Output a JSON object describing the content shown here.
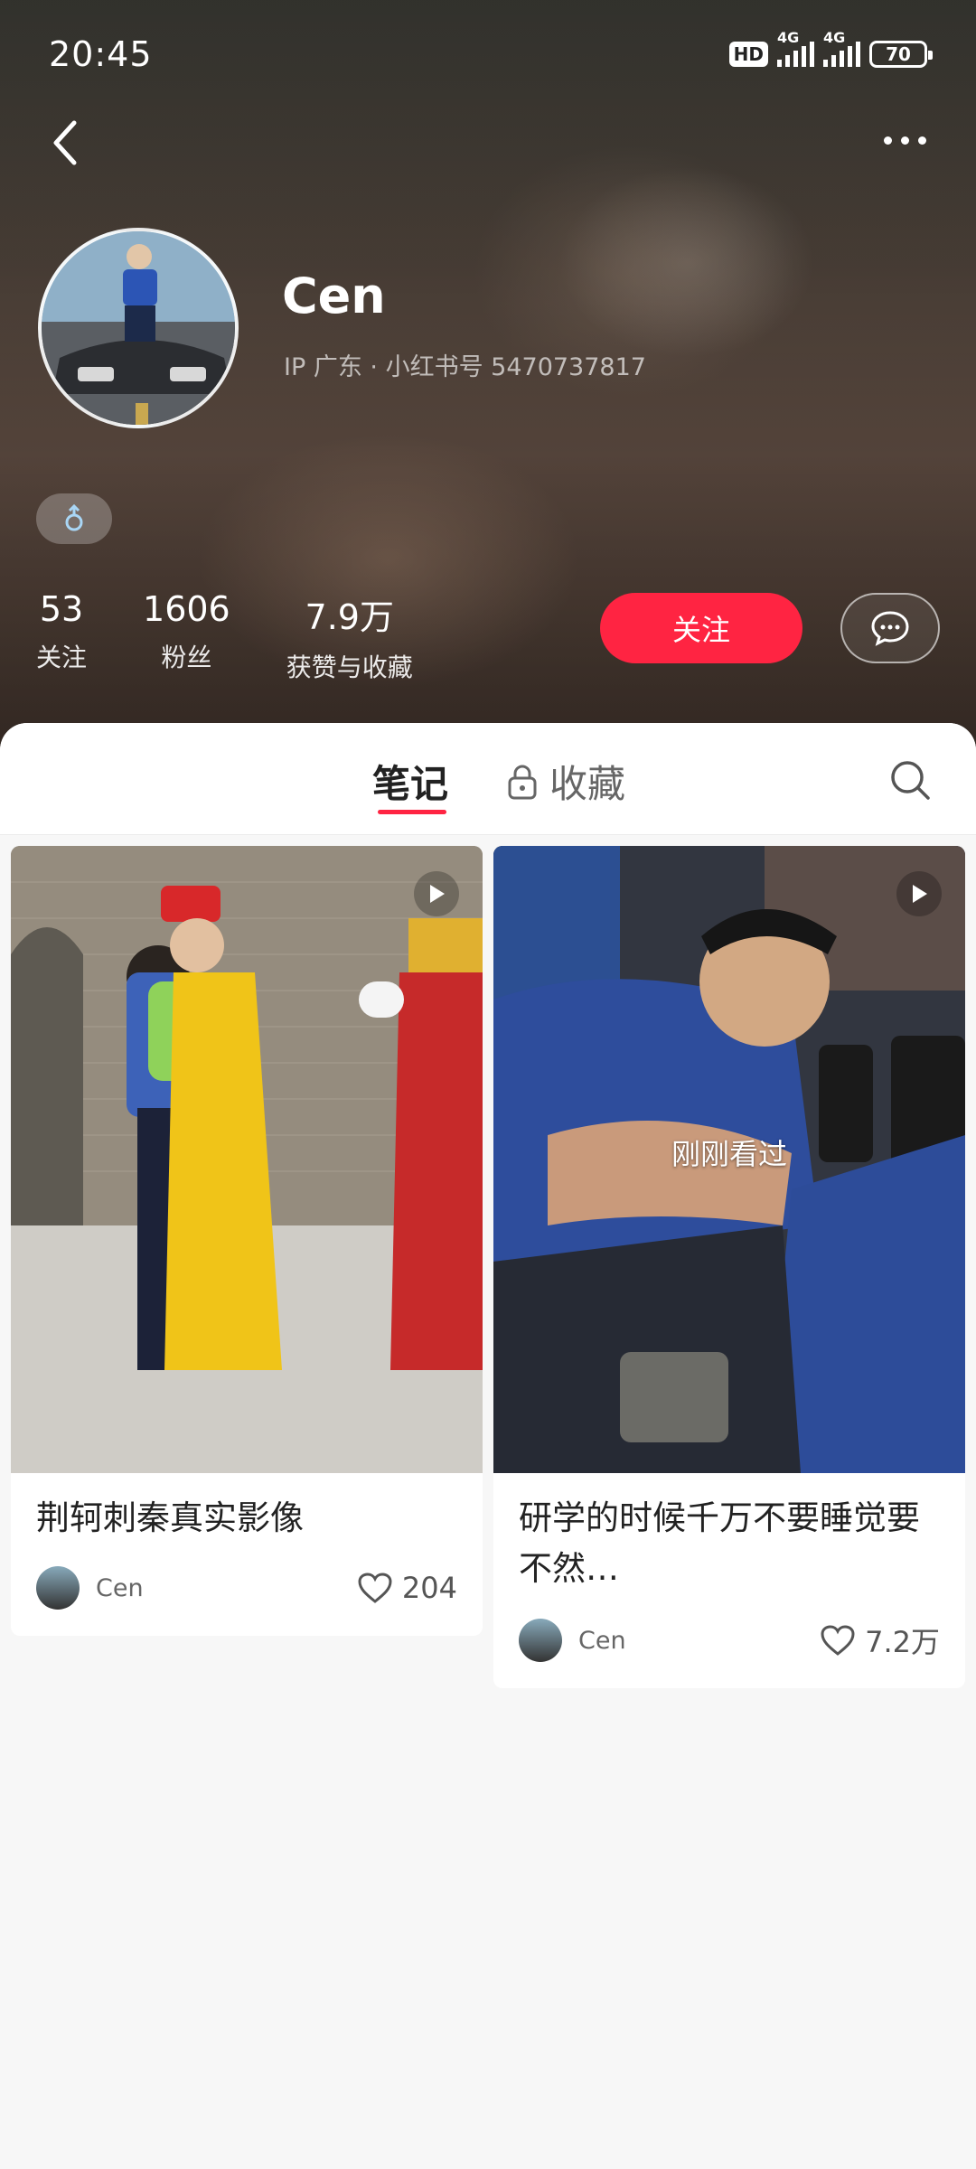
{
  "status_bar": {
    "time": "20:45",
    "hd": "HD",
    "network1": "4G",
    "network2": "4G",
    "battery": "70"
  },
  "profile": {
    "username": "Cen",
    "meta": "IP 广东 · 小红书号 5470737817",
    "gender_icon": "male-icon",
    "stats": [
      {
        "value": "53",
        "label": "关注"
      },
      {
        "value": "1606",
        "label": "粉丝"
      },
      {
        "value": "7.9万",
        "label": "获赞与收藏"
      }
    ],
    "follow_label": "关注"
  },
  "tabs": {
    "notes": "笔记",
    "favorites": "收藏"
  },
  "notes": [
    {
      "title": "荆轲刺秦真实影像",
      "author": "Cen",
      "likes": "204",
      "is_video": true,
      "viewed_label": ""
    },
    {
      "title": "研学的时候千万不要睡觉要不然…",
      "author": "Cen",
      "likes": "7.2万",
      "is_video": true,
      "viewed_label": "刚刚看过"
    }
  ],
  "colors": {
    "accent": "#ff2442"
  }
}
